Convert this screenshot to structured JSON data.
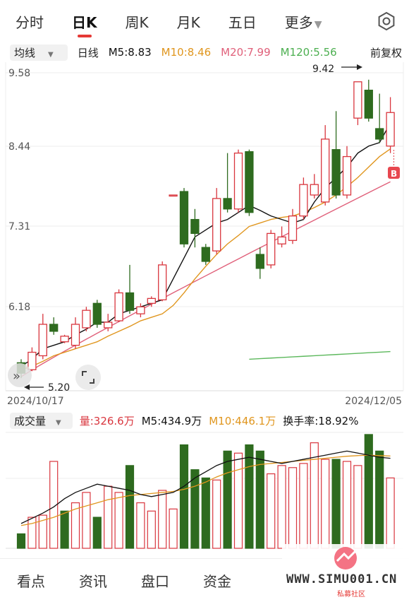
{
  "tabs": [
    {
      "label": "分时"
    },
    {
      "label": "日K"
    },
    {
      "label": "周K"
    },
    {
      "label": "月K"
    },
    {
      "label": "五日"
    },
    {
      "label": "更多"
    }
  ],
  "ma_bar": {
    "select_label": "均线",
    "period_label": "日线",
    "m5": "M5:8.83",
    "m10": "M10:8.46",
    "m20": "M20:7.99",
    "m120": "M120:5.56",
    "adjust_label": "前复权"
  },
  "price_axis": [
    "9.58",
    "8.44",
    "7.31",
    "6.18"
  ],
  "annotations": {
    "high_label": "9.42",
    "low_label": "5.20",
    "buy_marker": "B"
  },
  "dates": {
    "start": "2024/10/17",
    "end": "2024/12/05"
  },
  "volume_bar": {
    "select_label": "成交量",
    "vol": "量:326.6万",
    "m5": "M5:434.9万",
    "m10": "M10:446.1万",
    "turnover": "换手率:18.92%"
  },
  "bottom_nav": [
    {
      "label": "看点"
    },
    {
      "label": "资讯"
    },
    {
      "label": "盘口"
    },
    {
      "label": "资金"
    }
  ],
  "watermark": {
    "site": "WWW.SIMU001.CN",
    "sub": "私募社区"
  },
  "colors": {
    "up": "#d9363e",
    "down": "#2e6b1f",
    "m5": "#111111",
    "m10": "#e0961e",
    "m20": "#e0607a",
    "m120": "#5cb85c",
    "accent": "#e53935"
  },
  "chart_data": {
    "type": "candlestick",
    "ylim": [
      5.05,
      9.65
    ],
    "candles": [
      {
        "o": 5.4,
        "c": 5.25,
        "h": 5.45,
        "l": 5.18
      },
      {
        "o": 5.3,
        "c": 5.55,
        "h": 5.62,
        "l": 5.28
      },
      {
        "o": 5.5,
        "c": 5.95,
        "h": 6.1,
        "l": 5.45
      },
      {
        "o": 5.95,
        "c": 5.85,
        "h": 6.05,
        "l": 5.8
      },
      {
        "o": 5.7,
        "c": 5.78,
        "h": 5.8,
        "l": 5.68
      },
      {
        "o": 5.65,
        "c": 5.95,
        "h": 6.05,
        "l": 5.6
      },
      {
        "o": 5.9,
        "c": 6.15,
        "h": 6.2,
        "l": 5.85
      },
      {
        "o": 6.25,
        "c": 5.95,
        "h": 6.3,
        "l": 5.9
      },
      {
        "o": 5.9,
        "c": 5.98,
        "h": 6.1,
        "l": 5.85
      },
      {
        "o": 6.0,
        "c": 6.4,
        "h": 6.45,
        "l": 5.98
      },
      {
        "o": 6.4,
        "c": 6.15,
        "h": 6.8,
        "l": 6.1
      },
      {
        "o": 6.1,
        "c": 6.2,
        "h": 6.25,
        "l": 6.05
      },
      {
        "o": 6.25,
        "c": 6.32,
        "h": 6.35,
        "l": 6.2
      },
      {
        "o": 6.3,
        "c": 6.8,
        "h": 6.85,
        "l": 6.28
      },
      {
        "o": 7.8,
        "c": 7.8,
        "h": 7.8,
        "l": 7.8
      },
      {
        "o": 7.85,
        "c": 7.1,
        "h": 7.9,
        "l": 7.05
      },
      {
        "o": 7.45,
        "c": 7.25,
        "h": 7.6,
        "l": 7.05
      },
      {
        "o": 7.05,
        "c": 6.85,
        "h": 7.1,
        "l": 6.8
      },
      {
        "o": 7.0,
        "c": 7.75,
        "h": 7.9,
        "l": 6.95
      },
      {
        "o": 7.75,
        "c": 7.6,
        "h": 8.4,
        "l": 7.55
      },
      {
        "o": 7.6,
        "c": 8.4,
        "h": 8.45,
        "l": 7.55
      },
      {
        "o": 8.42,
        "c": 7.55,
        "h": 8.45,
        "l": 7.5
      },
      {
        "o": 6.95,
        "c": 6.75,
        "h": 7.05,
        "l": 6.6
      },
      {
        "o": 6.8,
        "c": 7.25,
        "h": 7.3,
        "l": 6.75
      },
      {
        "o": 7.1,
        "c": 7.2,
        "h": 7.35,
        "l": 7.05
      },
      {
        "o": 7.15,
        "c": 7.5,
        "h": 7.6,
        "l": 7.1
      },
      {
        "o": 7.5,
        "c": 7.95,
        "h": 8.05,
        "l": 7.45
      },
      {
        "o": 7.8,
        "c": 7.95,
        "h": 8.1,
        "l": 7.75
      },
      {
        "o": 7.7,
        "c": 8.6,
        "h": 8.8,
        "l": 7.65
      },
      {
        "o": 8.45,
        "c": 7.8,
        "h": 9.0,
        "l": 7.75
      },
      {
        "o": 7.8,
        "c": 8.35,
        "h": 8.5,
        "l": 7.75
      },
      {
        "o": 8.9,
        "c": 9.42,
        "h": 9.42,
        "l": 8.8
      },
      {
        "o": 9.3,
        "c": 8.9,
        "h": 9.45,
        "l": 8.85
      },
      {
        "o": 8.75,
        "c": 8.6,
        "h": 9.25,
        "l": 8.55
      },
      {
        "o": 8.5,
        "c": 8.98,
        "h": 9.2,
        "l": 8.4
      }
    ],
    "ma5": [
      5.35,
      5.45,
      5.6,
      5.65,
      5.7,
      5.8,
      5.88,
      5.98,
      5.98,
      6.1,
      6.15,
      6.2,
      6.25,
      6.3,
      6.6,
      6.9,
      7.2,
      7.3,
      7.4,
      7.45,
      7.55,
      7.65,
      7.58,
      7.5,
      7.45,
      7.4,
      7.45,
      7.7,
      7.9,
      8.05,
      8.2,
      8.4,
      8.5,
      8.55,
      8.83
    ],
    "ma10": [
      5.3,
      5.35,
      5.42,
      5.5,
      5.55,
      5.6,
      5.65,
      5.7,
      5.78,
      5.85,
      5.92,
      6.0,
      6.05,
      6.1,
      6.22,
      6.4,
      6.6,
      6.78,
      6.95,
      7.1,
      7.22,
      7.35,
      7.4,
      7.45,
      7.48,
      7.5,
      7.55,
      7.62,
      7.7,
      7.8,
      7.92,
      8.05,
      8.2,
      8.35,
      8.46
    ],
    "ma20_range": [
      5.2,
      7.99
    ],
    "ma120_range": [
      5.45,
      5.56
    ],
    "volume": {
      "values": [
        70,
        150,
        160,
        420,
        180,
        220,
        270,
        150,
        300,
        270,
        400,
        220,
        180,
        280,
        190,
        500,
        380,
        340,
        330,
        470,
        460,
        500,
        470,
        360,
        400,
        390,
        410,
        510,
        430,
        430,
        420,
        400,
        550,
        470,
        340
      ],
      "up": [
        false,
        true,
        true,
        true,
        false,
        true,
        true,
        false,
        true,
        true,
        false,
        true,
        true,
        true,
        true,
        false,
        false,
        false,
        true,
        false,
        true,
        false,
        false,
        true,
        true,
        true,
        true,
        true,
        true,
        false,
        true,
        true,
        false,
        false,
        true
      ],
      "ma5": [
        120,
        145,
        170,
        200,
        240,
        270,
        290,
        310,
        300,
        290,
        280,
        260,
        250,
        260,
        270,
        300,
        340,
        370,
        400,
        420,
        430,
        440,
        430,
        420,
        410,
        420,
        430,
        440,
        450,
        460,
        470,
        460,
        450,
        440,
        435
      ],
      "ma10": [
        110,
        120,
        135,
        150,
        170,
        190,
        205,
        220,
        235,
        245,
        255,
        260,
        265,
        270,
        275,
        285,
        300,
        320,
        345,
        365,
        380,
        395,
        405,
        410,
        415,
        420,
        425,
        430,
        435,
        440,
        445,
        448,
        450,
        448,
        446
      ]
    }
  }
}
